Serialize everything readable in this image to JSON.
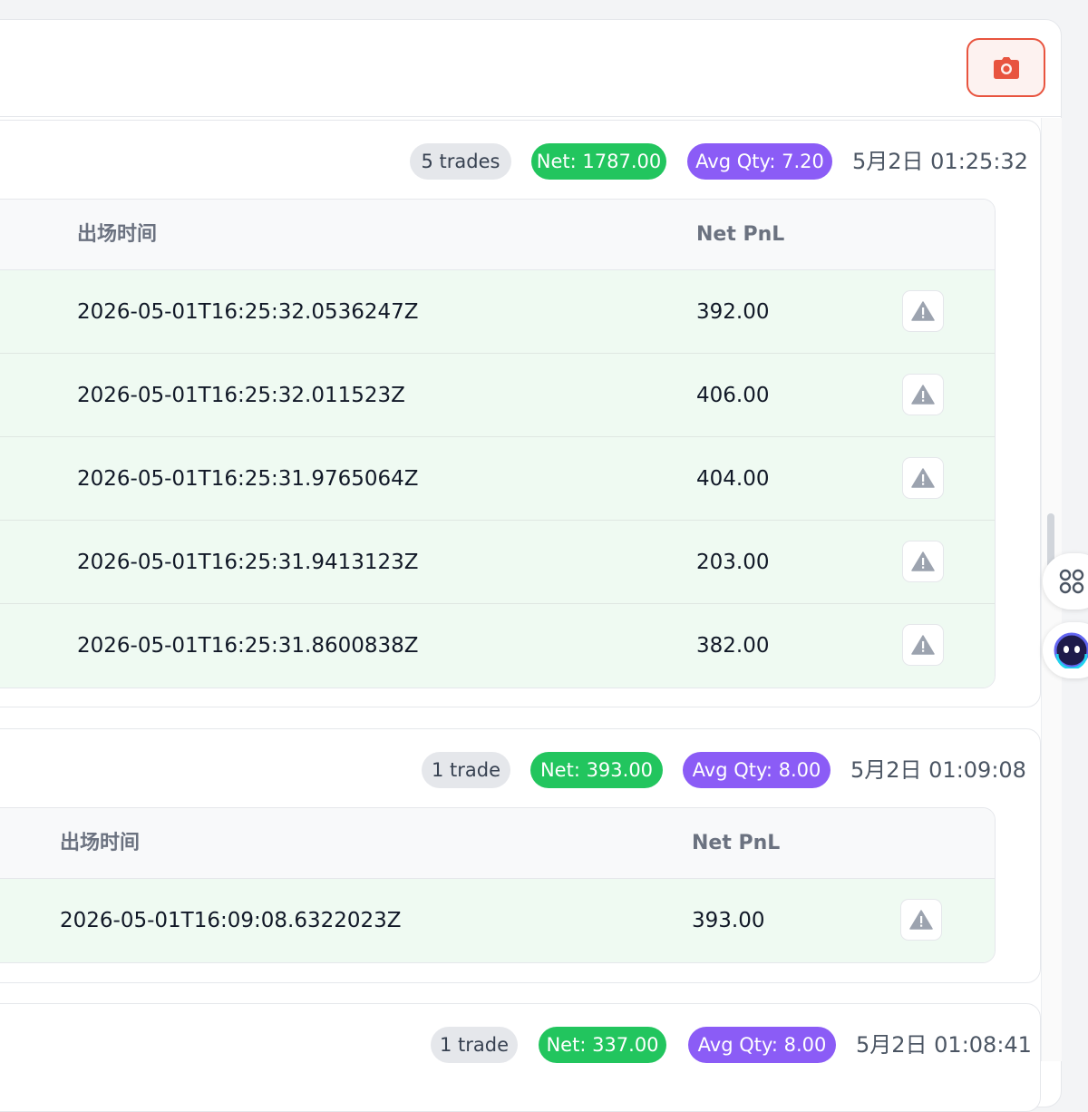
{
  "header": {
    "camera_icon": "camera-icon",
    "accent": "#e8543f"
  },
  "groups": [
    {
      "trade_count": "5 trades",
      "net": "Net: 1787.00",
      "avg_qty": "Avg Qty: 7.20",
      "timestamp": "5月2日 01:25:32",
      "columns": {
        "exit_time": "出场时间",
        "net_pnl": "Net PnL"
      },
      "rows": [
        {
          "exit_time": "2026-05-01T16:25:32.0536247Z",
          "net_pnl": "392.00"
        },
        {
          "exit_time": "2026-05-01T16:25:32.011523Z",
          "net_pnl": "406.00"
        },
        {
          "exit_time": "2026-05-01T16:25:31.9765064Z",
          "net_pnl": "404.00"
        },
        {
          "exit_time": "2026-05-01T16:25:31.9413123Z",
          "net_pnl": "203.00"
        },
        {
          "exit_time": "2026-05-01T16:25:31.8600838Z",
          "net_pnl": "382.00"
        }
      ]
    },
    {
      "trade_count": "1 trade",
      "net": "Net: 393.00",
      "avg_qty": "Avg Qty: 8.00",
      "timestamp": "5月2日 01:09:08",
      "columns": {
        "exit_time": "出场时间",
        "net_pnl": "Net PnL"
      },
      "rows": [
        {
          "exit_time": "2026-05-01T16:09:08.6322023Z",
          "net_pnl": "393.00"
        }
      ]
    },
    {
      "trade_count": "1 trade",
      "net": "Net: 337.00",
      "avg_qty": "Avg Qty: 8.00",
      "timestamp": "5月2日 01:08:41"
    }
  ],
  "colors": {
    "net_badge": "#22c55e",
    "avg_badge": "#8b5cf6",
    "row_bg": "#effaf2"
  },
  "floating": {
    "apps_icon": "command-icon",
    "assistant_icon": "assistant-avatar-icon"
  }
}
